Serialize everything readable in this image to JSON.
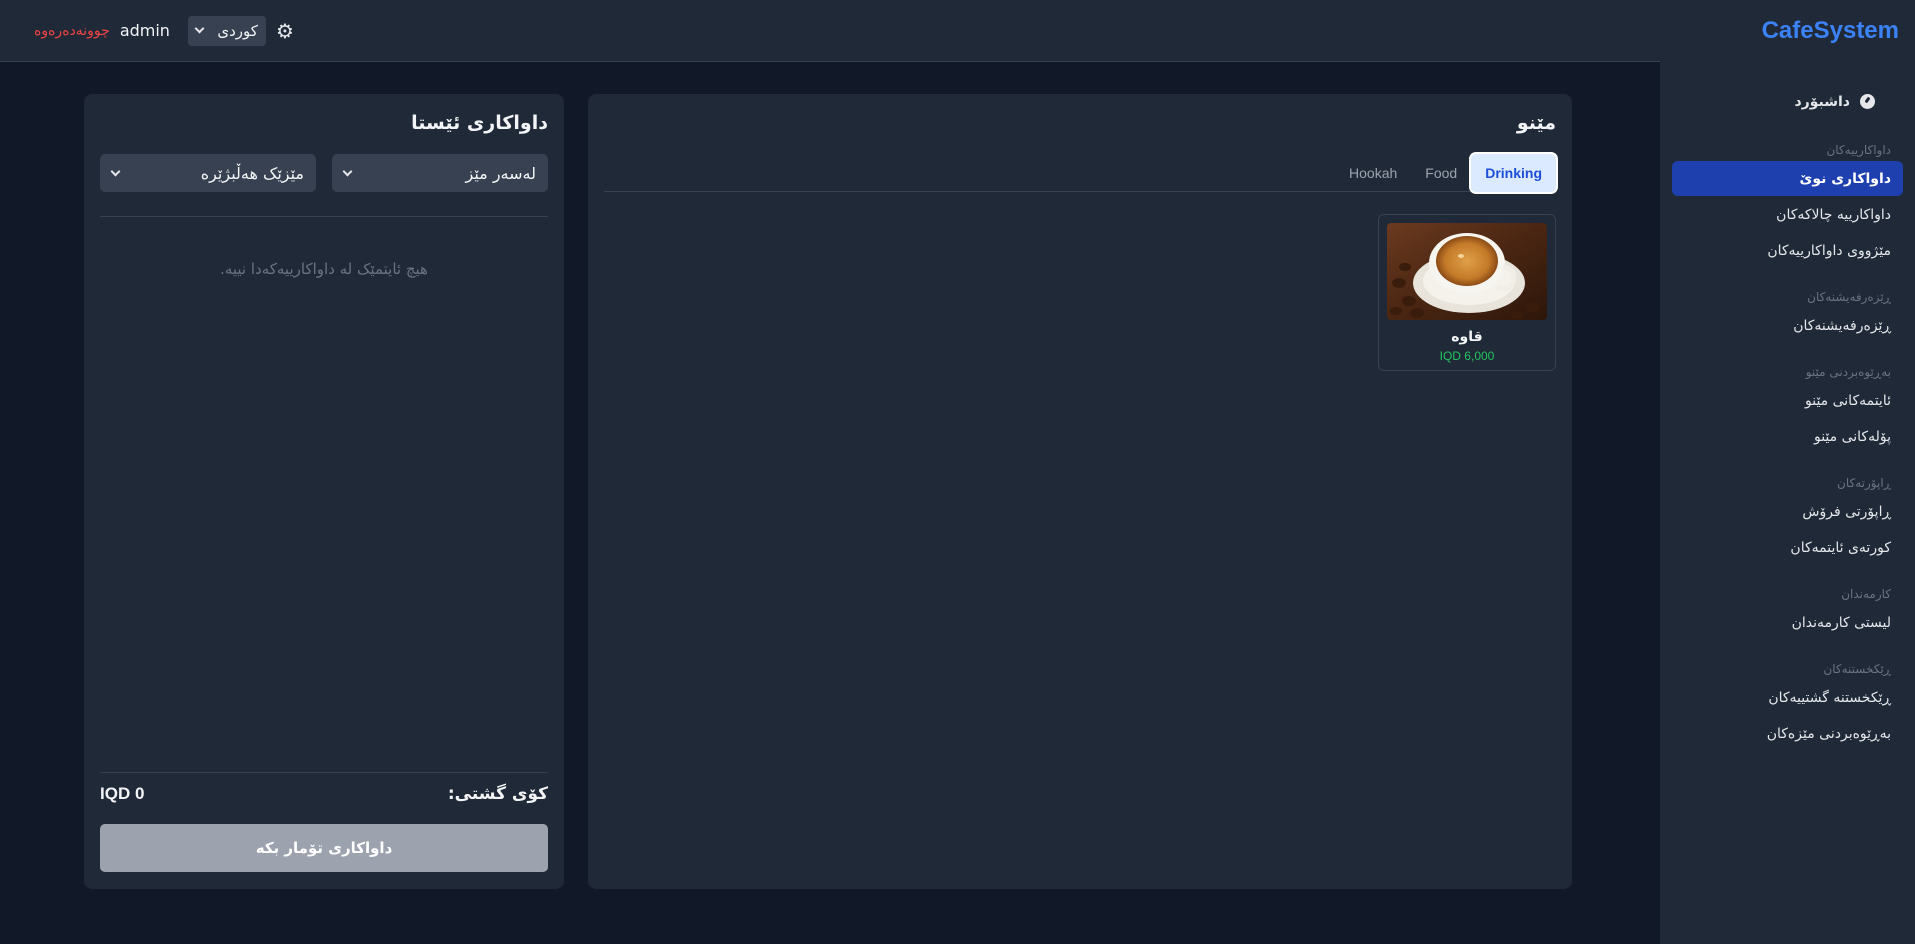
{
  "app": {
    "brand": "CafeSystem"
  },
  "header": {
    "logout_label": "چوونەدەرەوە",
    "user_name": "admin",
    "language_selected": "کوردی"
  },
  "sidebar": {
    "dashboard": "داشبۆرد",
    "sections": [
      {
        "title": "داواکارییەکان",
        "items": [
          "داواکاری نوێ",
          "داواکارییە چالاکەکان",
          "مێژووی داواکارییەکان"
        ]
      },
      {
        "title": "ڕێزەرفەیشنەکان",
        "items": [
          "ڕێزەرفەیشنەکان"
        ]
      },
      {
        "title": "بەڕێوەبردنی مێنو",
        "items": [
          "ئایتمەکانی مێنو",
          "پۆلەکانی مێنو"
        ]
      },
      {
        "title": "ڕاپۆرتەکان",
        "items": [
          "ڕاپۆرتی فرۆش",
          "کورتەی ئایتمەکان"
        ]
      },
      {
        "title": "کارمەندان",
        "items": [
          "لیستی کارمەندان"
        ]
      },
      {
        "title": "ڕێکخستنەکان",
        "items": [
          "ڕێکخستنە گشتییەکان",
          "بەڕێوەبردنی مێزەکان"
        ]
      }
    ],
    "active_item": "داواکاری نوێ"
  },
  "menu": {
    "title": "مێنو",
    "tabs": [
      "Drinking",
      "Food",
      "Hookah"
    ],
    "active_tab": "Drinking",
    "items": [
      {
        "name": "قاوە",
        "price": "IQD 6,000"
      }
    ]
  },
  "order": {
    "title": "داواکاری ئێستا",
    "order_type": "لەسەر مێز",
    "table_placeholder": "مێزێک هەڵبژێرە",
    "empty_message": "هیچ ئایتمێک لە داواکارییەکەدا نییە.",
    "total_label": "کۆی گشتی:",
    "total_value": "IQD 0",
    "save_label": "داواکاری تۆمار بکە"
  },
  "colors": {
    "accent": "#3b82f6",
    "active_nav": "#1e40af",
    "price": "#22c55e",
    "logout": "#ef4444"
  }
}
